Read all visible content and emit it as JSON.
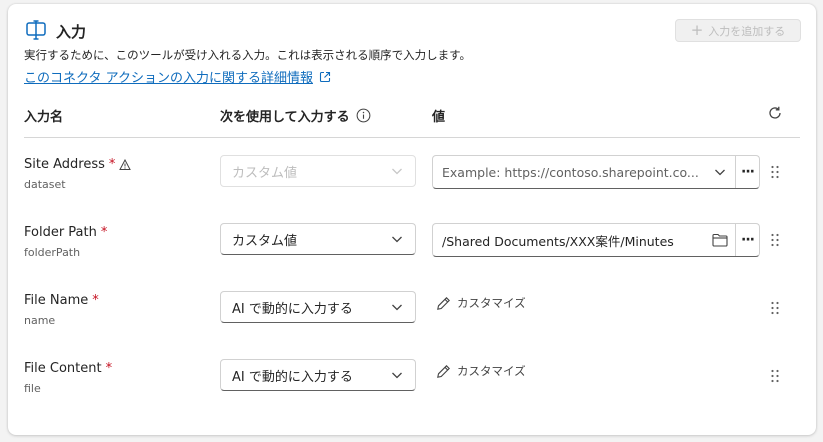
{
  "panel": {
    "title": "入力",
    "add_button": "入力を追加する",
    "description": "実行するために、このツールが受け入れる入力。これは表示される順序で入力します。",
    "learn_more": "このコネクタ アクションの入力に関する詳細情報"
  },
  "columns": {
    "name": "入力名",
    "fill_using": "次を使用して入力する",
    "value": "値"
  },
  "rows": [
    {
      "name": "Site Address",
      "required": "*",
      "key": "dataset",
      "fill_using": "カスタム値",
      "value_placeholder": "Example: https://contoso.sharepoint.co..."
    },
    {
      "name": "Folder Path",
      "required": "*",
      "key": "folderPath",
      "fill_using": "カスタム値",
      "value": "/Shared Documents/XXX案件/Minutes"
    },
    {
      "name": "File Name",
      "required": "*",
      "key": "name",
      "fill_using": "AI で動的に入力する",
      "customize": "カスタマイズ"
    },
    {
      "name": "File Content",
      "required": "*",
      "key": "file",
      "fill_using": "AI で動的に入力する",
      "customize": "カスタマイズ"
    }
  ],
  "more_label": "···",
  "icons": {
    "title": "input-panel-icon",
    "info": "info-icon",
    "refresh": "refresh-icon",
    "warning": "warning-icon",
    "chevron": "chevron-down-icon",
    "folder": "folder-icon",
    "pencil": "pencil-icon",
    "grip": "drag-handle-icon",
    "external": "external-link-icon"
  },
  "colors": {
    "link": "#0f6cbd",
    "required": "#c50f1f"
  }
}
